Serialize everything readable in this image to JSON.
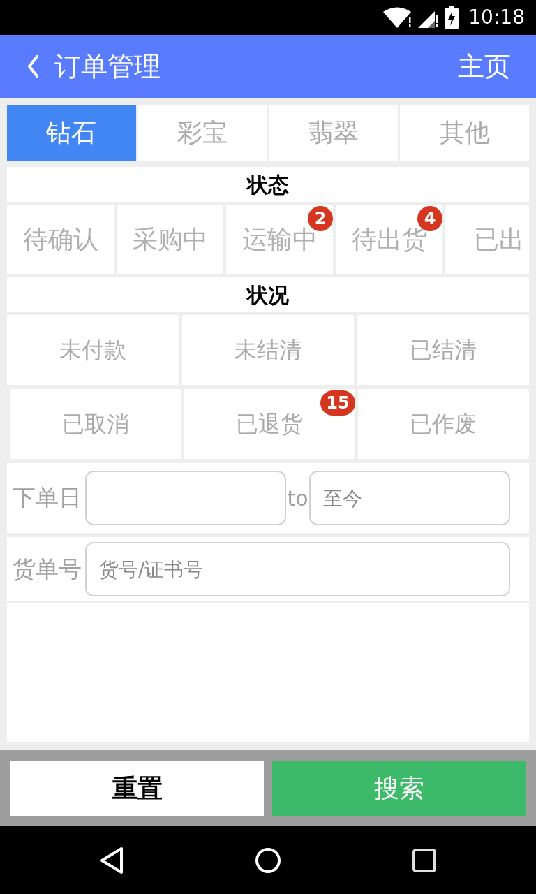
{
  "status_bar": {
    "time": "10:18"
  },
  "header": {
    "title": "订单管理",
    "home_link": "主页"
  },
  "categories": [
    {
      "label": "钻石",
      "selected": true
    },
    {
      "label": "彩宝",
      "selected": false
    },
    {
      "label": "翡翠",
      "selected": false
    },
    {
      "label": "其他",
      "selected": false
    }
  ],
  "status_section": {
    "title": "状态",
    "items": [
      {
        "label": "待确认",
        "selected": false
      },
      {
        "label": "采购中",
        "selected": false
      },
      {
        "label": "运输中",
        "selected": false,
        "badge": "2"
      },
      {
        "label": "待出货",
        "selected": false,
        "badge": "4"
      },
      {
        "label": "已出",
        "selected": false
      }
    ]
  },
  "condition_section": {
    "title": "状况",
    "items": [
      {
        "label": "未付款",
        "selected": false
      },
      {
        "label": "未结清",
        "selected": false
      },
      {
        "label": "已结清",
        "selected": false
      },
      {
        "label": "已取消",
        "selected": false
      },
      {
        "label": "已退货",
        "selected": false,
        "badge": "15"
      },
      {
        "label": "已作废",
        "selected": false
      }
    ]
  },
  "order_date": {
    "label": "下单日",
    "separator": "to",
    "to_placeholder": "至今"
  },
  "order_number": {
    "label": "货单号",
    "placeholder": "货号/证书号"
  },
  "buttons": [
    {
      "label": "重置",
      "kind": "reset"
    },
    {
      "label": "搜索",
      "kind": "search"
    }
  ]
}
